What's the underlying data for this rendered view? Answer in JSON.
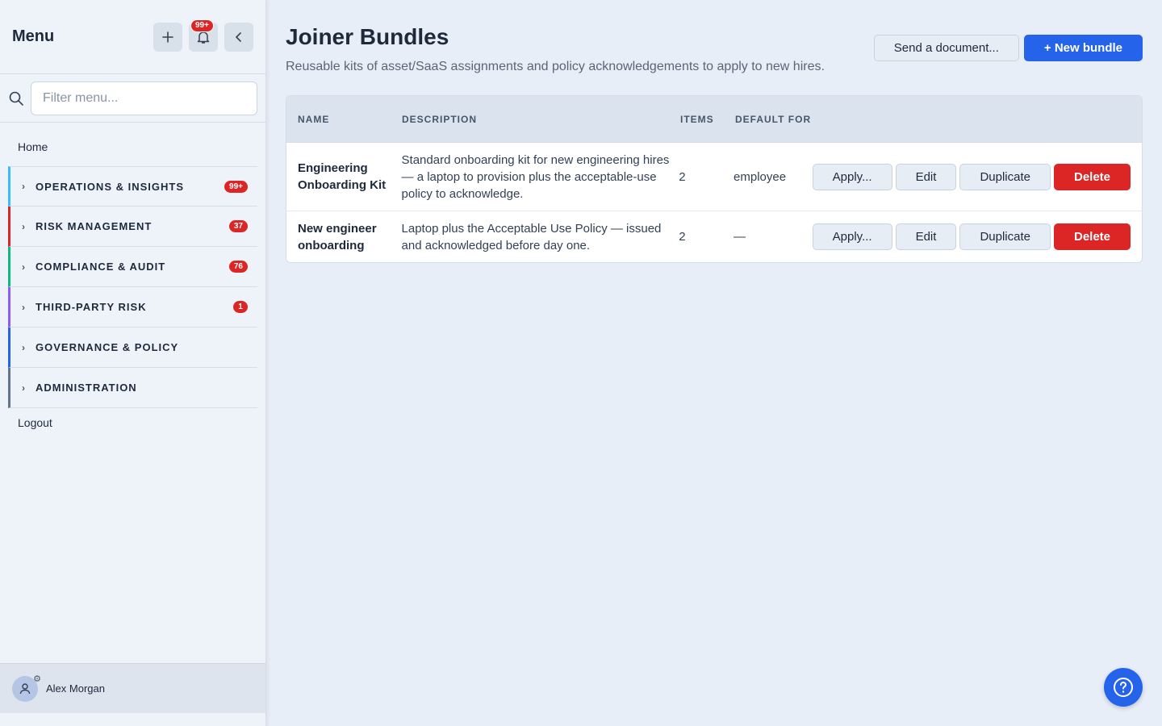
{
  "sidebar": {
    "title": "Menu",
    "notification_badge": "99+",
    "filter_placeholder": "Filter menu...",
    "home": "Home",
    "sections": [
      {
        "label": "OPERATIONS & INSIGHTS",
        "badge": "99+",
        "color": "#38bdf8"
      },
      {
        "label": "RISK MANAGEMENT",
        "badge": "37",
        "color": "#dc2626"
      },
      {
        "label": "COMPLIANCE & AUDIT",
        "badge": "76",
        "color": "#10b981"
      },
      {
        "label": "THIRD-PARTY RISK",
        "badge": "1",
        "color": "#8b5cf6"
      },
      {
        "label": "GOVERNANCE & POLICY",
        "badge": "",
        "color": "#2563eb"
      },
      {
        "label": "ADMINISTRATION",
        "badge": "",
        "color": "#64748b"
      }
    ],
    "logout": "Logout",
    "user_name": "Alex Morgan"
  },
  "page": {
    "title": "Joiner Bundles",
    "subtitle": "Reusable kits of asset/SaaS assignments and policy acknowledgements to apply to new hires.",
    "send_document": "Send a document...",
    "new_bundle": "+ New bundle"
  },
  "table": {
    "headers": {
      "name": "NAME",
      "description": "DESCRIPTION",
      "items": "ITEMS",
      "default_for": "DEFAULT FOR"
    },
    "rows": [
      {
        "name": "Engineering Onboarding Kit",
        "description": "Standard onboarding kit for new engineering hires — a laptop to provision plus the acceptable-use policy to acknowledge.",
        "items": "2",
        "default_for": "employee"
      },
      {
        "name": "New engineer onboarding",
        "description": "Laptop plus the Acceptable Use Policy — issued and acknowledged before day one.",
        "items": "2",
        "default_for": "—"
      }
    ],
    "actions": {
      "apply": "Apply...",
      "edit": "Edit",
      "duplicate": "Duplicate",
      "delete": "Delete"
    }
  },
  "colors": {
    "primary": "#2563eb",
    "danger": "#dc2626"
  },
  "icons": {
    "add": "plus-icon",
    "notifications": "bell-icon",
    "collapse": "chevron-left-icon",
    "search": "search-icon",
    "help": "help-icon",
    "user": "user-icon"
  }
}
